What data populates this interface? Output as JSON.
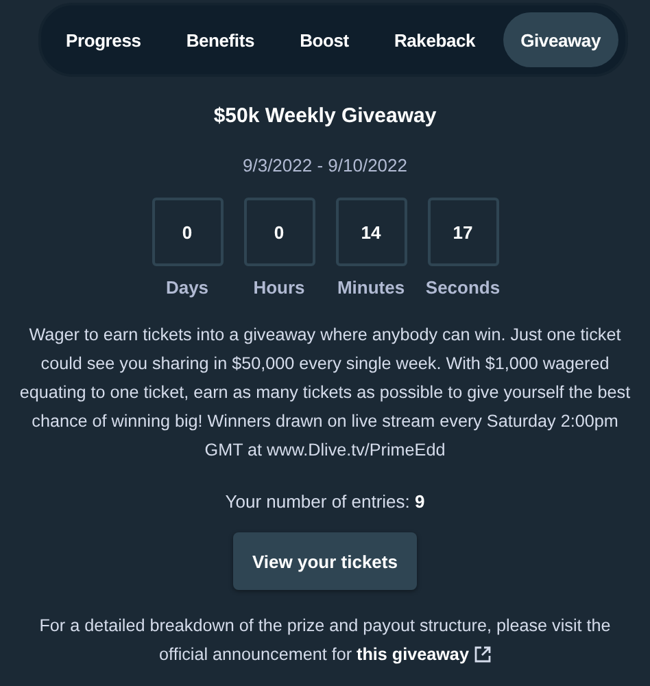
{
  "tabs": [
    {
      "label": "Progress",
      "selected": false
    },
    {
      "label": "Benefits",
      "selected": false
    },
    {
      "label": "Boost",
      "selected": false
    },
    {
      "label": "Rakeback",
      "selected": false
    },
    {
      "label": "Giveaway",
      "selected": true
    }
  ],
  "title": "$50k Weekly Giveaway",
  "dates": "9/3/2022 - 9/10/2022",
  "countdown": [
    {
      "value": "0",
      "unit": "Days"
    },
    {
      "value": "0",
      "unit": "Hours"
    },
    {
      "value": "14",
      "unit": "Minutes"
    },
    {
      "value": "17",
      "unit": "Seconds"
    }
  ],
  "description": "Wager to earn tickets into a giveaway where anybody can win. Just one ticket could see you sharing in $50,000 every single week. With $1,000 wagered equating to one ticket, earn as many tickets as possible to give yourself the best chance of winning big! Winners drawn on live stream every Saturday 2:00pm GMT at www.Dlive.tv/PrimeEdd",
  "entries": "Your number of entries: **9**",
  "button": "View your tickets",
  "footer": {
    "text": "For a detailed breakdown of the prize and payout structure, please visit the official announcement for",
    "link": "this giveaway"
  }
}
